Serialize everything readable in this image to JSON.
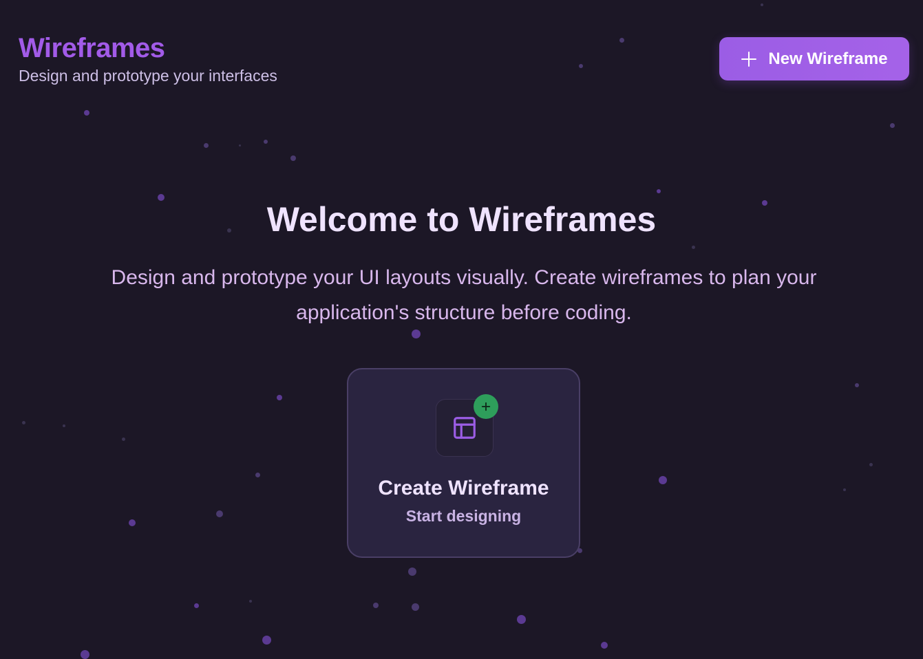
{
  "header": {
    "title": "Wireframes",
    "subtitle": "Design and prototype your interfaces",
    "new_button_label": "New Wireframe"
  },
  "hero": {
    "title": "Welcome to Wireframes",
    "description": "Design and prototype your UI layouts visually. Create wireframes to plan your application's structure before coding."
  },
  "create_card": {
    "title": "Create Wireframe",
    "subtitle": "Start designing",
    "icon": "layout-icon",
    "badge_icon": "plus-icon"
  },
  "colors": {
    "background": "#1c1726",
    "accent": "#a25be8",
    "button": "#9b5de5",
    "card": "#2a2440",
    "badge": "#2e9e5b"
  }
}
